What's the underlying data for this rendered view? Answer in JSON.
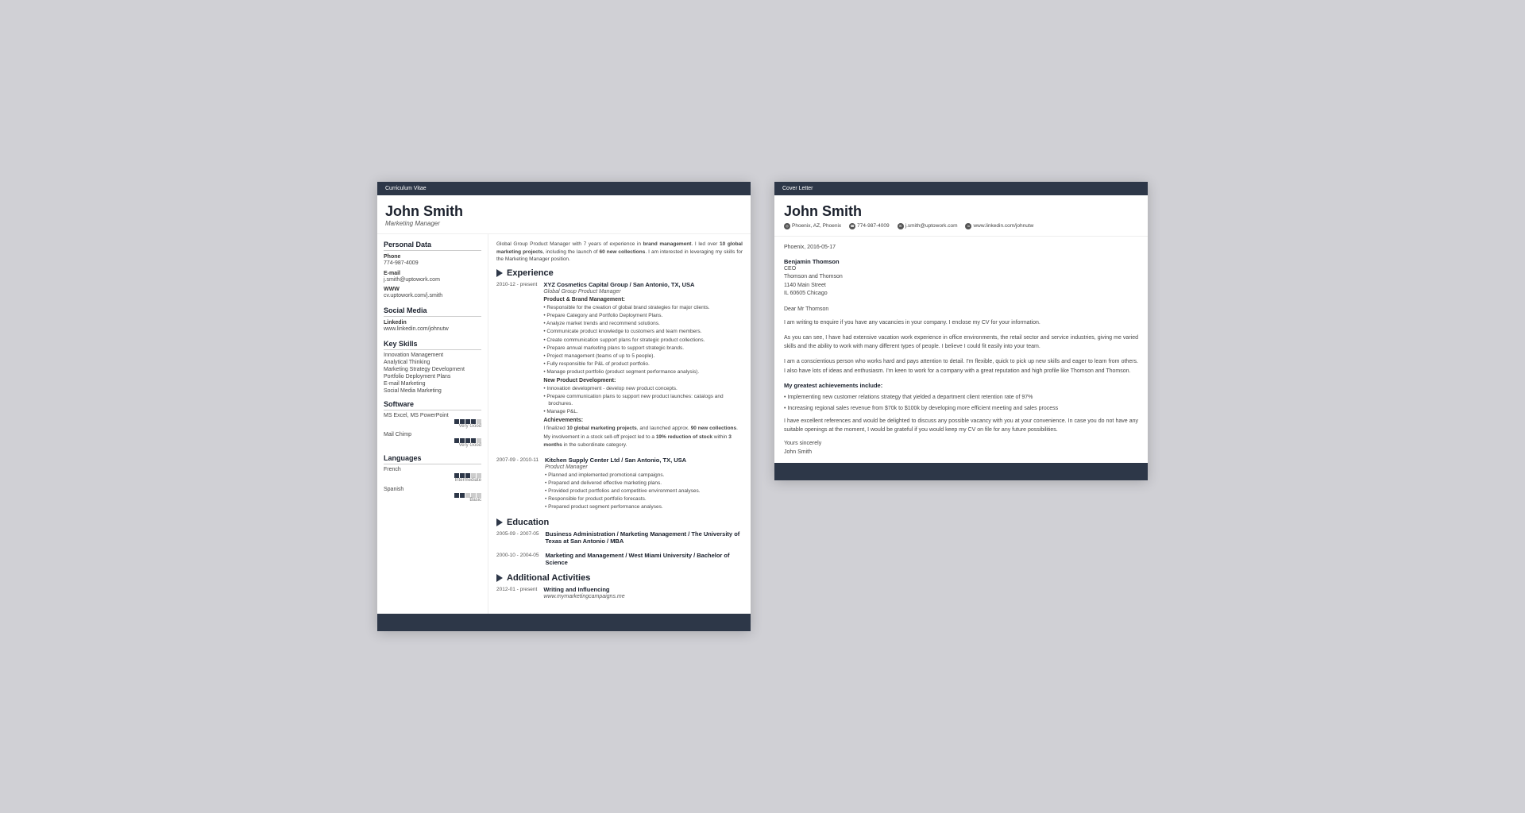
{
  "cv": {
    "header_bar": "Curriculum Vitae",
    "name": "John Smith",
    "title": "Marketing Manager",
    "left": {
      "personal_data_title": "Personal Data",
      "phone_label": "Phone",
      "phone_value": "774-987-4009",
      "email_label": "E-mail",
      "email_value": "j.smith@uptowork.com",
      "www_label": "WWW",
      "www_value": "cv.uptowork.com/j.smith",
      "social_media_title": "Social Media",
      "linkedin_label": "Linkedin",
      "linkedin_value": "www.linkedin.com/johnutw",
      "key_skills_title": "Key Skills",
      "skills": [
        "Innovation Management",
        "Analytical Thinking",
        "Marketing Strategy Development",
        "Portfolio Deployment Plans",
        "E-mail Marketing",
        "Social Media Marketing"
      ],
      "software_title": "Software",
      "software": [
        {
          "name": "MS Excel, MS PowerPoint",
          "level": 4,
          "max": 5,
          "label": "Very Good"
        },
        {
          "name": "Mail Chimp",
          "level": 4,
          "max": 5,
          "label": "Very Good"
        }
      ],
      "languages_title": "Languages",
      "languages": [
        {
          "name": "French",
          "level": 3,
          "max": 5,
          "label": "Intermediate"
        },
        {
          "name": "Spanish",
          "level": 2,
          "max": 5,
          "label": "Basic"
        }
      ]
    },
    "right": {
      "intro": "Global Group Product Manager with 7 years of experience in brand management. I led over 10 global marketing projects, including the launch of 60 new collections. I am interested in leveraging my skills for the Marketing Manager position.",
      "experience_title": "Experience",
      "experience": [
        {
          "date": "2010-12 - present",
          "company": "XYZ Cosmetics Capital Group / San Antonio, TX, USA",
          "role": "Global Group Product Manager",
          "sub_sections": [
            {
              "title": "Product & Brand Management:",
              "bullets": [
                "Responsible for the creation of global brand strategies for major clients.",
                "Prepare Category and Portfolio Deployment Plans.",
                "Analyze market trends and recommend solutions.",
                "Communicate product knowledge to customers and team members.",
                "Create communication support plans for strategic product collections.",
                "Prepare annual marketing plans to support strategic brands.",
                "Project management (teams of up to 5 people).",
                "Fully responsible for P&L of product portfolio.",
                "Manage product portfolio (product segment performance analysis)."
              ]
            },
            {
              "title": "New Product Development:",
              "bullets": [
                "Innovation development - develop new product concepts.",
                "Prepare communication plans to support new product launches: catalogs and brochures.",
                "Manage P&L."
              ]
            },
            {
              "title": "Achievements:",
              "text": "I finalized 10 global marketing projects, and launched approx. 90 new collections.\nMy involvement in a stock sell-off project led to a 19% reduction of stock within 3 months in the subordinate category."
            }
          ]
        },
        {
          "date": "2007-09 - 2010-11",
          "company": "Kitchen Supply Center Ltd / San Antonio, TX, USA",
          "role": "Product Manager",
          "bullets": [
            "Planned and implemented promotional campaigns.",
            "Prepared and delivered effective marketing plans.",
            "Provided product portfolios and competitive environment analyses.",
            "Responsible for product portfolio forecasts.",
            "Prepared product segment performance analyses."
          ]
        }
      ],
      "education_title": "Education",
      "education": [
        {
          "date": "2005-09 - 2007-05",
          "degree": "Business Administration / Marketing Management / The University of Texas at San Antonio / MBA"
        },
        {
          "date": "2000-10 - 2004-05",
          "degree": "Marketing and Management / West Miami University / Bachelor of Science"
        }
      ],
      "activities_title": "Additional Activities",
      "activities": [
        {
          "date": "2012-01 - present",
          "title": "Writing and Influencing",
          "value": "www.mymarketingcampaigns.me"
        }
      ]
    }
  },
  "cl": {
    "header_bar": "Cover Letter",
    "name": "John Smith",
    "contact": {
      "location": "Phoenix, AZ, Phoenix",
      "phone": "774-987-4009",
      "email": "j.smith@uptowork.com",
      "linkedin": "www.linkedin.com/johnutw"
    },
    "date": "Phoenix, 2016-05-17",
    "recipient": {
      "name": "Benjamin Thomson",
      "title": "CEO",
      "company": "Thomson and Thomson",
      "address": "1140 Main Street",
      "city": "IL 60605 Chicago"
    },
    "salutation": "Dear Mr Thomson",
    "paragraphs": [
      "I am writing to enquire if you have any vacancies in your company. I enclose my CV for your information.",
      "As you can see, I have had extensive vacation work experience in office environments, the retail sector and service industries, giving me varied skills and the ability to work with many different types of people. I believe I could fit easily into your team.",
      "I am a conscientious person who works hard and pays attention to detail. I'm flexible, quick to pick up new skills and eager to learn from others. I also have lots of ideas and enthusiasm. I'm keen to work for a company with a great reputation and high profile like Thomson and Thomson."
    ],
    "achievements_title": "My greatest achievements include:",
    "achievements": [
      "Implementing new customer relations strategy that yielded a department client retention rate of 97%",
      "Increasing regional sales revenue from $70k to $100k by developing more efficient meeting and sales process"
    ],
    "closing_paragraph": "I have excellent references and would be delighted to discuss any possible vacancy with you at your convenience. In case you do not have any suitable openings at the moment, I would be grateful if you would keep my CV on file for any future possibilities.",
    "closing": "Yours sincerely",
    "signature": "John Smith"
  }
}
